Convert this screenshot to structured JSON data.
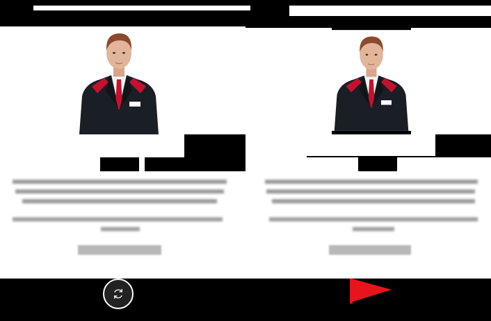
{
  "left_card": {
    "avatar": "business-man-avatar",
    "heading": "",
    "paragraph": "",
    "caption": ""
  },
  "right_card": {
    "avatar": "business-man-avatar",
    "heading": "",
    "paragraph": "",
    "caption": ""
  },
  "controls": {
    "refresh_icon": "refresh-icon",
    "flag_icon": "flag-icon",
    "flag_color": "#e8141c"
  },
  "colors": {
    "background": "#000000",
    "tie": "#c8102e",
    "suit": "#1a1f26",
    "skin": "#e2b49a",
    "hair": "#8b4a2b"
  }
}
